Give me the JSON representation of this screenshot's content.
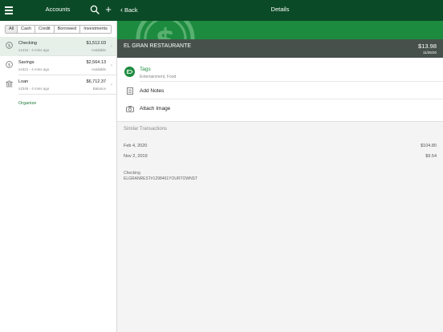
{
  "left": {
    "title": "Accounts",
    "filters": [
      "All",
      "Cash",
      "Credit",
      "Borrowed",
      "Investments"
    ],
    "accounts": [
      {
        "name": "Checking",
        "sub": "x1234 - 4 mins ago",
        "amount": "$1,512.03",
        "type": "Available",
        "icon": "dollar-circle-icon"
      },
      {
        "name": "Savings",
        "sub": "x4321 - 4 mins ago",
        "amount": "$2,564.13",
        "type": "Available",
        "icon": "dollar-circle-icon"
      },
      {
        "name": "Loan",
        "sub": "x2345 - 4 mins ago",
        "amount": "$6,712.37",
        "type": "Balance",
        "icon": "bank-icon"
      }
    ],
    "organize": "Organize"
  },
  "right": {
    "back_label": "Back",
    "title": "Details",
    "merchant": {
      "name": "EL GRAN RESTAURANTE",
      "amount": "$13.98",
      "date": "11/26/20"
    },
    "tags": {
      "label": "Tags",
      "value": "Entertainment, Food"
    },
    "add_notes": "Add Notes",
    "attach_image": "Attach Image",
    "similar_title": "Similar Transactions",
    "similar": [
      {
        "date": "Feb 4, 2020",
        "amount": "$104.80"
      },
      {
        "date": "Nov 2, 2019",
        "amount": "$9.54"
      }
    ],
    "memo": {
      "account": "Checking",
      "description": "ELGRANREST#1298461YOURTOWNST"
    }
  },
  "colors": {
    "header": "#0b4a26",
    "accent": "#1d8b3f",
    "merchant_bar": "#47514b",
    "link": "#1e7a3a"
  }
}
